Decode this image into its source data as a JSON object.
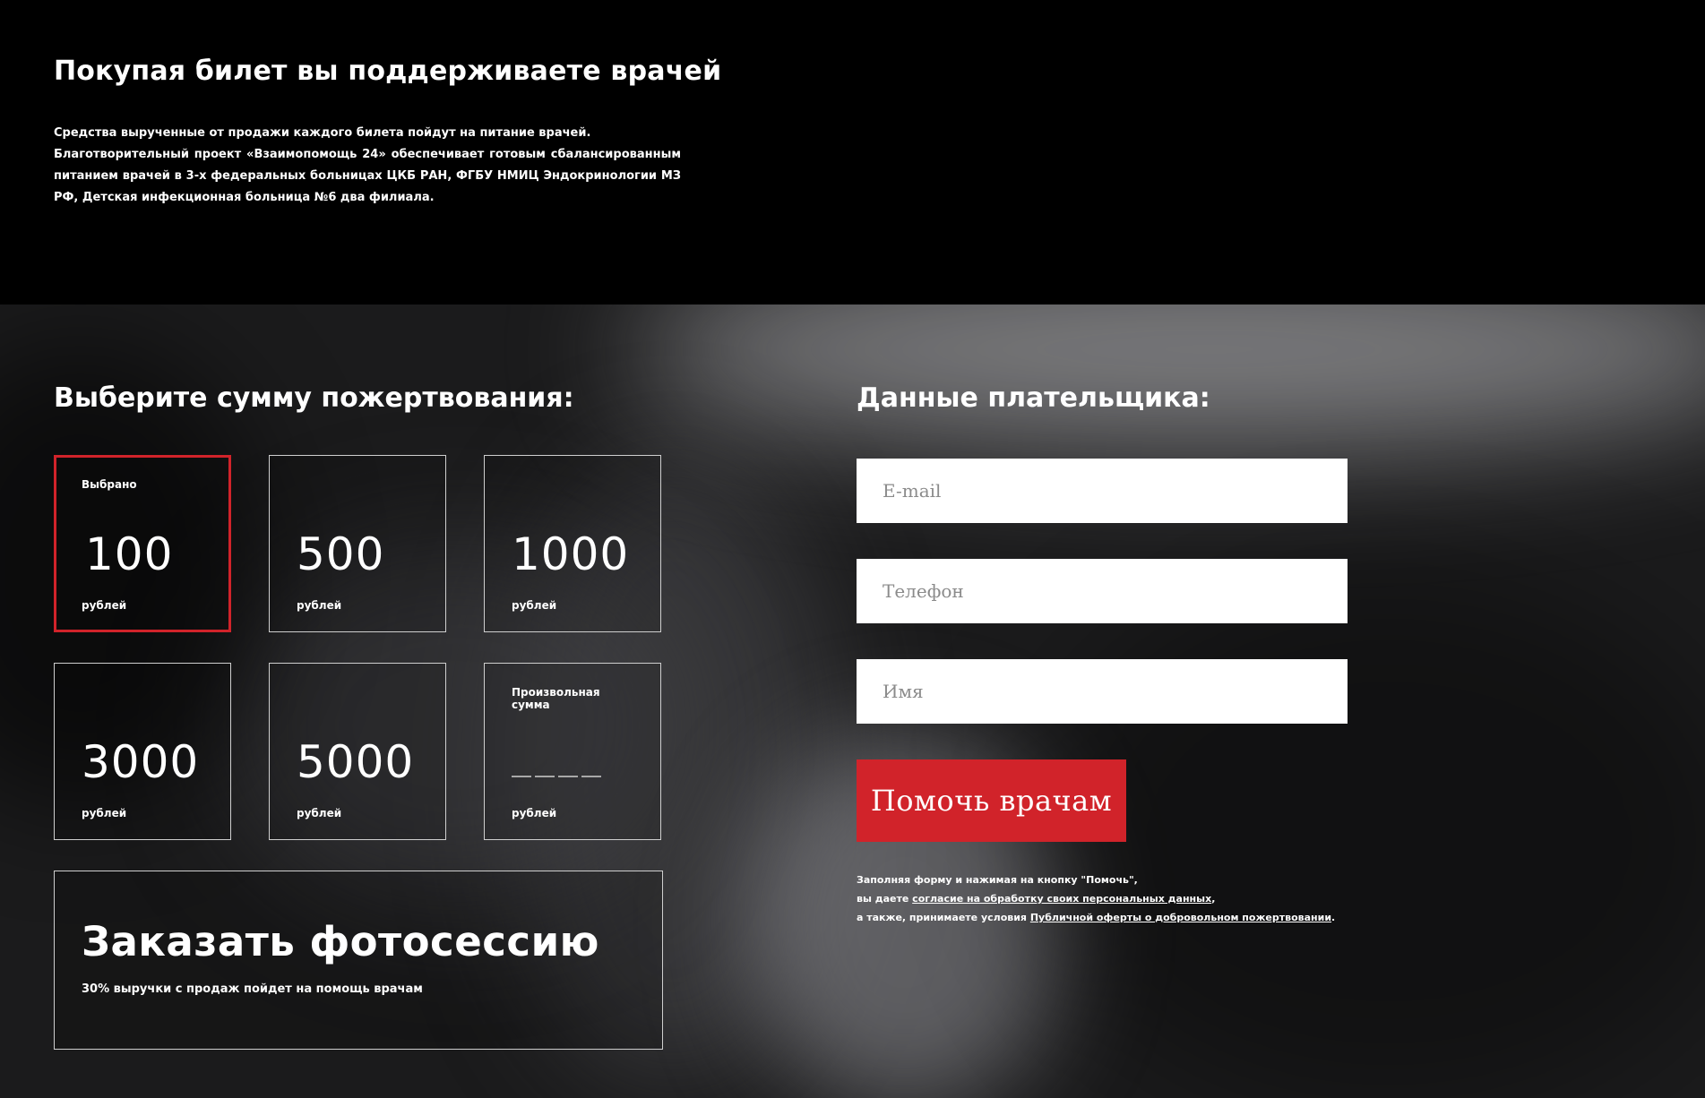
{
  "info": {
    "title": "Покупая билет вы поддерживаете врачей",
    "paragraph1": "Средства вырученные от продажи каждого билета пойдут на питание врачей.",
    "paragraph2": "Благотворительный проект «Взаимопомощь 24» обеспечивает готовым сбалансированным питанием врачей в 3-х федеральных больницах ЦКБ РАН, ФГБУ НМИЦ Эндокринологии МЗ РФ, Детская инфекционная больница №6 два филиала."
  },
  "donation": {
    "heading": "Выберите сумму пожертвования:",
    "selected_label": "Выбрано",
    "unit": "рублей",
    "amounts": [
      "100",
      "500",
      "1000",
      "3000",
      "5000"
    ],
    "selected_amount": "100",
    "custom_label": "Произвольная сумма",
    "photo_title": "Заказать фотосессию",
    "photo_subtitle": "30% выручки с продаж пойдет на помощь врачам"
  },
  "payer": {
    "heading": "Данные плательщика:",
    "email_placeholder": "E-mail",
    "phone_placeholder": "Телефон",
    "name_placeholder": "Имя",
    "submit_label": "Помочь врачам",
    "consent_line1": "Заполняя форму и нажимая на кнопку \"Помочь\",",
    "consent_line2_prefix": "вы даете ",
    "consent_link1": "согласие на обработку своих персональных данных",
    "consent_line2_suffix": ",",
    "consent_line3_prefix": "а также, принимаете условия ",
    "consent_link2": "Публичной оферты о добровольном пожертвовании",
    "consent_line3_suffix": "."
  },
  "colors": {
    "accent": "#d1232a",
    "background": "#000000",
    "field_background": "#ffffff"
  }
}
